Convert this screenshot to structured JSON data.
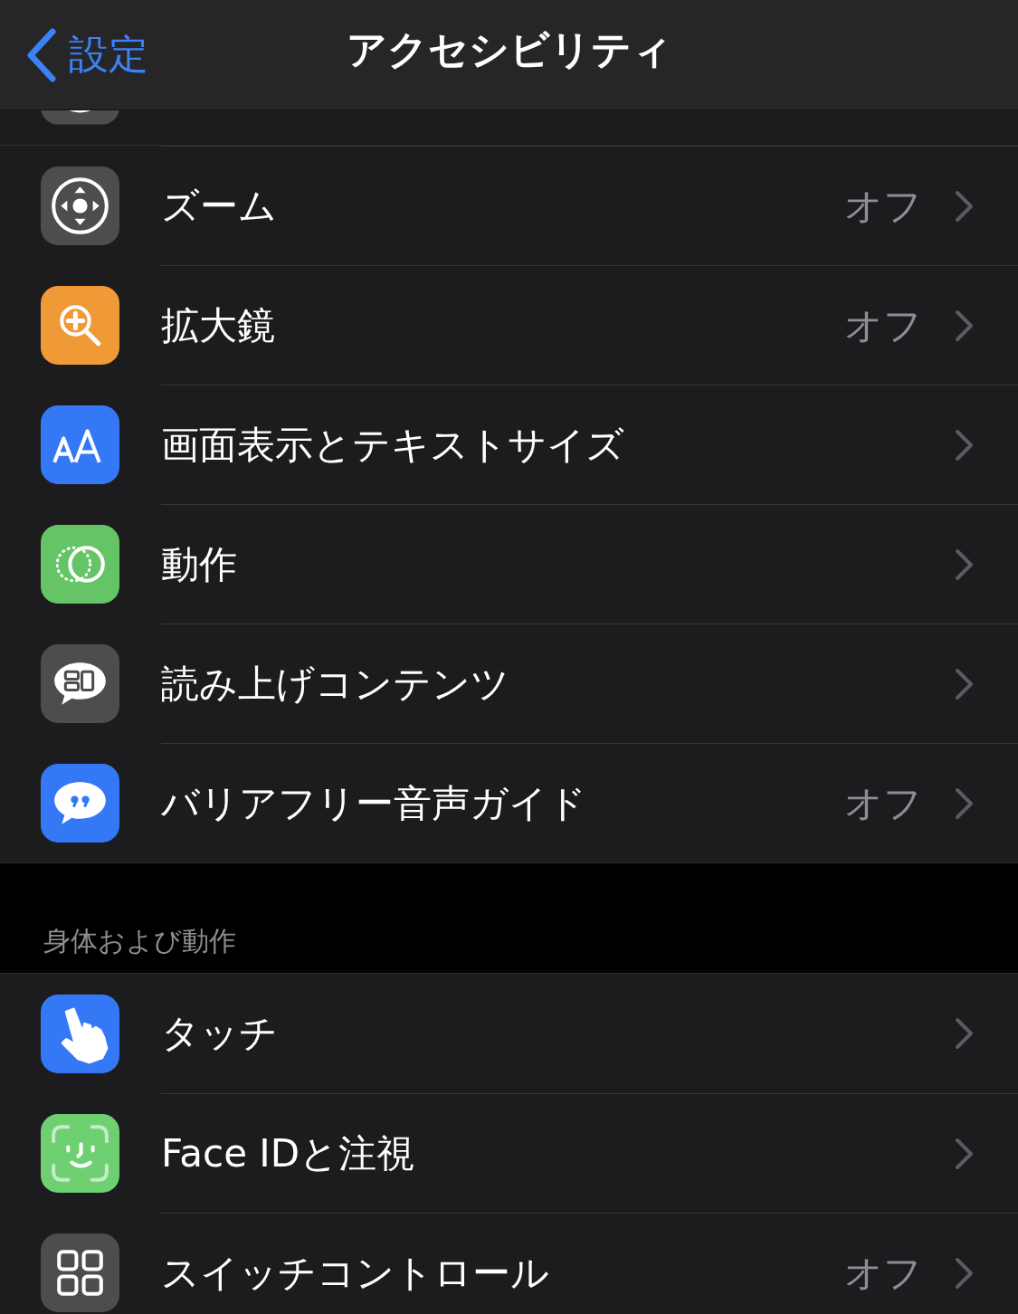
{
  "nav_bar": {
    "back_label": "設定",
    "title": "アクセシビリティ"
  },
  "sections": [
    {
      "items": [
        {
          "label": "ズーム",
          "value": "オフ"
        },
        {
          "label": "拡大鏡",
          "value": "オフ"
        },
        {
          "label": "画面表示とテキストサイズ"
        },
        {
          "label": "動作"
        },
        {
          "label": "読み上げコンテンツ"
        },
        {
          "label": "バリアフリー音声ガイド",
          "value": "オフ"
        }
      ]
    },
    {
      "header": "身体および動作",
      "items": [
        {
          "label": "タッチ"
        },
        {
          "label": "Face IDと注視"
        },
        {
          "label": "スイッチコントロール",
          "value": "オフ"
        }
      ]
    }
  ]
}
